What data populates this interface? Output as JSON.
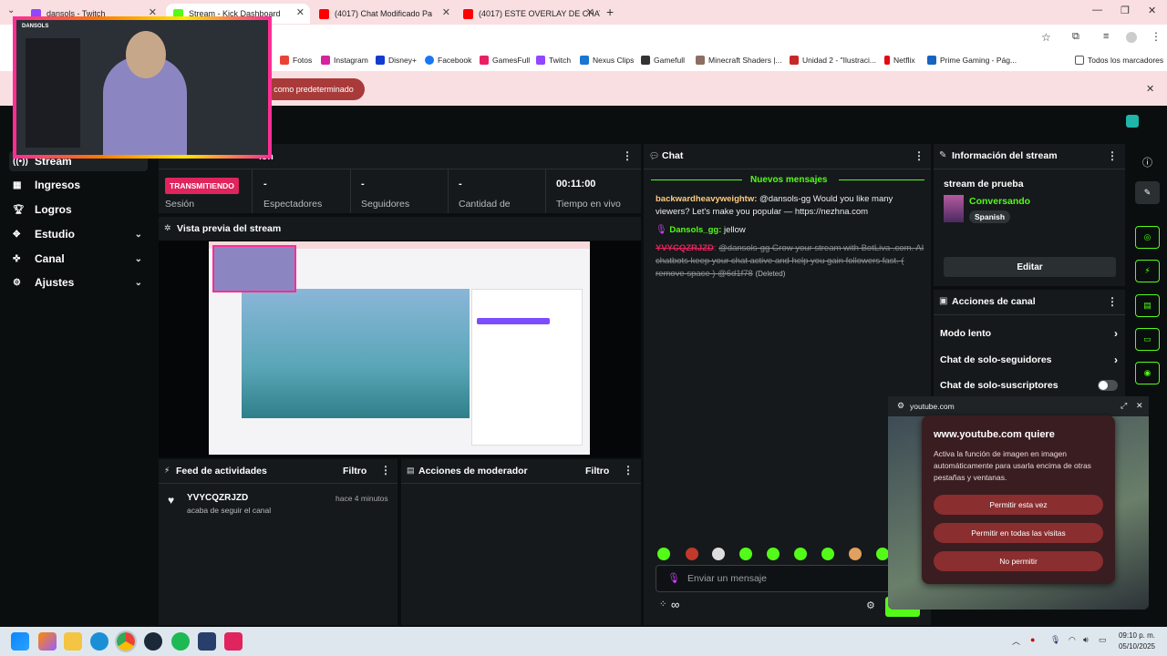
{
  "browser": {
    "tabs": [
      {
        "title": "dansols - Twitch",
        "color": "#9146ff"
      },
      {
        "title": "Stream - Kick Dashboard",
        "color": "#53fc18"
      },
      {
        "title": "(4017) Chat Modificado Pa",
        "color": "#ff0000"
      },
      {
        "title": "(4017) ESTE OVERLAY DE CHAT",
        "color": "#ff0000"
      }
    ],
    "new_tab": "+",
    "bookmarks": [
      {
        "label": "Fotos",
        "color": "#ea4335"
      },
      {
        "label": "Instagram",
        "color": "#d6249f"
      },
      {
        "label": "Disney+",
        "color": "#113ccf"
      },
      {
        "label": "Facebook",
        "color": "#1877f2"
      },
      {
        "label": "GamesFull",
        "color": "#e91e63"
      },
      {
        "label": "Twitch",
        "color": "#9146ff"
      },
      {
        "label": "Nexus Clips",
        "color": "#1976d2"
      },
      {
        "label": "Gamefull",
        "color": "#333333"
      },
      {
        "label": "Minecraft Shaders |...",
        "color": "#8d6e63"
      },
      {
        "label": "Unidad 2 - \"Ilustraci...",
        "color": "#c62828"
      },
      {
        "label": "Netflix",
        "color": "#e50914"
      },
      {
        "label": "Prime Gaming - Pág...",
        "color": "#1565c0"
      }
    ],
    "bookmarks_folder": "Todos los marcadores",
    "infobar_button": "como predeterminado"
  },
  "webcam": {
    "label": "DANSOLS"
  },
  "sidebar": {
    "items": [
      {
        "label": "Stream",
        "icon": "broadcast-icon"
      },
      {
        "label": "Ingresos",
        "icon": "chart-icon"
      },
      {
        "label": "Logros",
        "icon": "trophy-icon"
      },
      {
        "label": "Estudio",
        "icon": "studio-icon"
      },
      {
        "label": "Canal",
        "icon": "channel-icon"
      },
      {
        "label": "Ajustes",
        "icon": "gear-icon"
      }
    ]
  },
  "session": {
    "header_suffix": "ión",
    "status_badge": "TRANSMITIENDO",
    "stats": [
      {
        "value": "",
        "label": "Sesión"
      },
      {
        "value": "-",
        "label": "Espectadores"
      },
      {
        "value": "-",
        "label": "Seguidores"
      },
      {
        "value": "-",
        "label": "Cantidad de"
      },
      {
        "value": "00:11:00",
        "label": "Tiempo en vivo"
      }
    ]
  },
  "preview": {
    "title": "Vista previa del stream"
  },
  "activity": {
    "title": "Feed de actividades",
    "filter": "Filtro",
    "items": [
      {
        "user": "YVYCQZRJZD",
        "time": "hace 4 minutos",
        "text": "acaba de seguir el canal"
      }
    ]
  },
  "moderator": {
    "title": "Acciones de moderador",
    "filter": "Filtro"
  },
  "chat": {
    "title": "Chat",
    "new_messages": "Nuevos mensajes",
    "messages": [
      {
        "user": "backwardheavyweightw",
        "text": "@dansols-gg Would you like many viewers? Let's make you popular — https://nezhna.com",
        "user_color": "#ffcc80",
        "deleted": false
      },
      {
        "user": "Dansols_gg",
        "text": "jellow",
        "user_color": "#53fc18",
        "deleted": false
      },
      {
        "user": "YVYCQZRJZD",
        "text": "@dansols-gg Grow your stream with BotLiva .com. AI chatbots keep your chat active and help you gain followers fast. ( remove space ) @6d1f78",
        "user_color": "#e0245e",
        "deleted": true,
        "deleted_label": "(Deleted)"
      }
    ],
    "input_placeholder": "Enviar un mensaje",
    "infinity": "∞"
  },
  "stream_info": {
    "title": "Información del stream",
    "stream_title": "stream de prueba",
    "category": "Conversando",
    "language": "Spanish",
    "edit": "Editar"
  },
  "channel_actions": {
    "title": "Acciones de canal",
    "items": [
      {
        "label": "Modo lento",
        "control": "chevron"
      },
      {
        "label": "Chat de solo-seguidores",
        "control": "chevron"
      },
      {
        "label": "Chat de solo-suscriptores",
        "control": "toggle"
      }
    ]
  },
  "popup": {
    "domain": "youtube.com",
    "title": "www.youtube.com quiere",
    "body": "Activa la función de imagen en imagen automáticamente para usarla encima de otras pestañas y ventanas.",
    "buttons": [
      "Permitir esta vez",
      "Permitir en todas las visitas",
      "No permitir"
    ]
  },
  "taskbar": {
    "time": "09:10 p. m.",
    "date": "05/10/2025"
  }
}
